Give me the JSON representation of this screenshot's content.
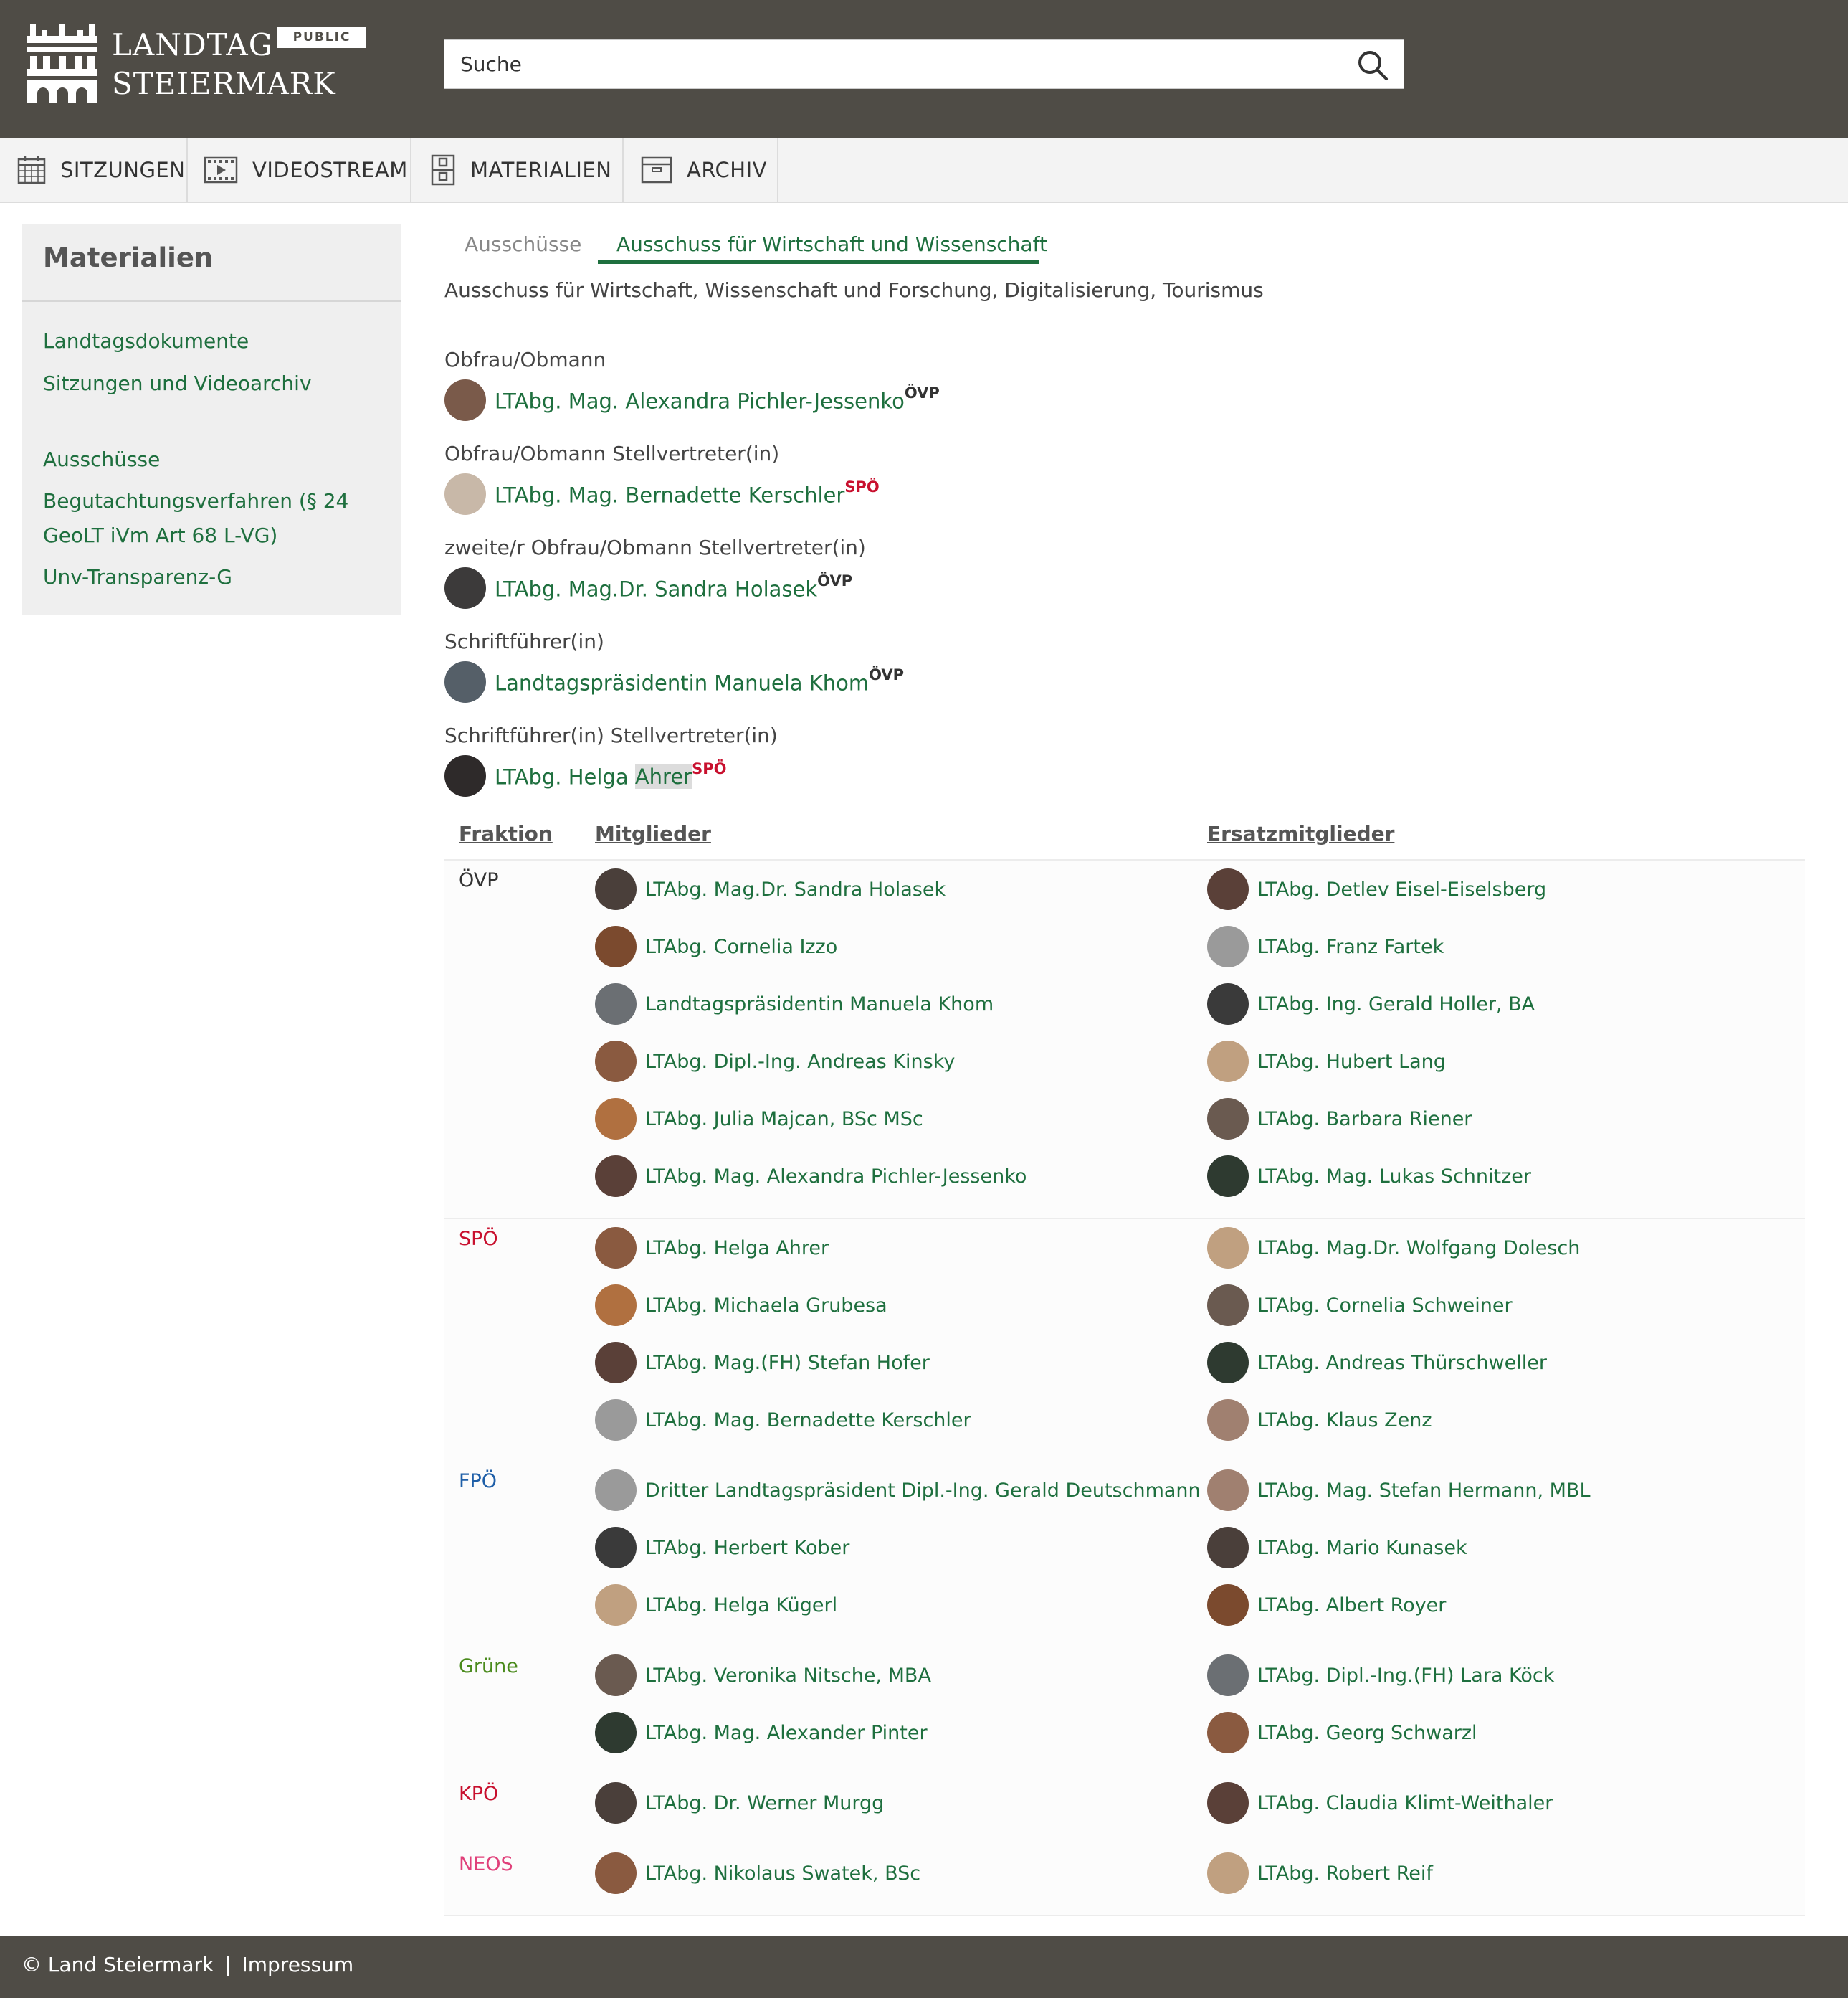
{
  "header": {
    "logo_line1": "LANDTAG",
    "logo_line2": "STEIERMARK",
    "badge": "PUBLIC",
    "search_placeholder": "Suche"
  },
  "nav": [
    {
      "label": "SITZUNGEN",
      "icon": "calendar-icon"
    },
    {
      "label": "VIDEOSTREAM",
      "icon": "video-icon"
    },
    {
      "label": "MATERIALIEN",
      "icon": "documents-icon"
    },
    {
      "label": "ARCHIV",
      "icon": "archive-box-icon"
    }
  ],
  "sidebar": {
    "title": "Materialien",
    "links": [
      {
        "label": "Landtagsdokumente"
      },
      {
        "label": "Sitzungen und Videoarchiv"
      },
      {
        "label": "Ausschüsse"
      },
      {
        "label": "Begutachtungsverfahren (§ 24"
      },
      {
        "label": "GeoLT iVm Art 68 L-VG)"
      },
      {
        "label": "Unv-Transparenz-G"
      }
    ]
  },
  "tabs": [
    {
      "label": "Ausschüsse"
    },
    {
      "label": "Ausschuss für Wirtschaft und Wissenschaft"
    }
  ],
  "subtitle": "Ausschuss für Wirtschaft, Wissenschaft und Forschung, Digitalisierung, Tourismus",
  "roles": [
    {
      "label": "Obfrau/Obmann",
      "name": "LTAbg. Mag. Alexandra Pichler-Jessenko",
      "party": "ÖVP"
    },
    {
      "label": "Obfrau/Obmann Stellvertreter(in)",
      "name": "LTAbg. Mag. Bernadette Kerschler",
      "party": "SPÖ"
    },
    {
      "label": "zweite/r Obfrau/Obmann Stellvertreter(in)",
      "name": "LTAbg. Mag.Dr. Sandra Holasek",
      "party": "ÖVP"
    },
    {
      "label": "Schriftführer(in)",
      "name": "Landtagspräsidentin Manuela Khom",
      "party": "ÖVP"
    },
    {
      "label": "Schriftführer(in) Stellvertreter(in)",
      "name": "LTAbg. Helga ",
      "name_hl": "Ahrer",
      "party": "SPÖ"
    }
  ],
  "table": {
    "headers": {
      "fraktion": "Fraktion",
      "mitglieder": "Mitglieder",
      "ersatz": "Ersatzmitglieder"
    },
    "groups": [
      {
        "fraktion": "ÖVP",
        "color": "#333333",
        "mitglieder": [
          "LTAbg. Mag.Dr. Sandra Holasek",
          "LTAbg. Cornelia Izzo",
          "Landtagspräsidentin Manuela Khom",
          "LTAbg. Dipl.-Ing. Andreas Kinsky",
          "LTAbg. Julia Majcan, BSc MSc",
          "LTAbg. Mag. Alexandra Pichler-Jessenko"
        ],
        "ersatz": [
          "LTAbg. Detlev Eisel-Eiselsberg",
          "LTAbg. Franz Fartek",
          "LTAbg. Ing. Gerald Holler, BA",
          "LTAbg. Hubert Lang",
          "LTAbg. Barbara Riener",
          "LTAbg. Mag. Lukas Schnitzer"
        ]
      },
      {
        "fraktion": "SPÖ",
        "color": "#c8102e",
        "mitglieder": [
          "LTAbg. Helga Ahrer",
          "LTAbg. Michaela Grubesa",
          "LTAbg. Mag.(FH) Stefan Hofer",
          "LTAbg. Mag. Bernadette Kerschler"
        ],
        "ersatz": [
          "LTAbg. Mag.Dr. Wolfgang Dolesch",
          "LTAbg. Cornelia Schweiner",
          "LTAbg. Andreas Thürschweller",
          "LTAbg. Klaus Zenz"
        ]
      },
      {
        "fraktion": "FPÖ",
        "color": "#1f5fa8",
        "mitglieder": [
          "Dritter Landtagspräsident Dipl.-Ing. Gerald Deutschmann",
          "LTAbg. Herbert Kober",
          "LTAbg. Helga Kügerl"
        ],
        "ersatz": [
          "LTAbg. Mag. Stefan Hermann, MBL",
          "LTAbg. Mario Kunasek",
          "LTAbg. Albert Royer"
        ]
      },
      {
        "fraktion": "Grüne",
        "color": "#4a8a1c",
        "mitglieder": [
          "LTAbg. Veronika Nitsche, MBA",
          "LTAbg. Mag. Alexander Pinter"
        ],
        "ersatz": [
          "LTAbg. Dipl.-Ing.(FH) Lara Köck",
          "LTAbg. Georg Schwarzl"
        ]
      },
      {
        "fraktion": "KPÖ",
        "color": "#c8102e",
        "mitglieder": [
          "LTAbg. Dr. Werner Murgg"
        ],
        "ersatz": [
          "LTAbg. Claudia Klimt-Weithaler"
        ]
      },
      {
        "fraktion": "NEOS",
        "color": "#e0407a",
        "mitglieder": [
          "LTAbg. Nikolaus Swatek, BSc"
        ],
        "ersatz": [
          "LTAbg. Robert Reif"
        ]
      }
    ]
  },
  "footer": {
    "copyright": "© Land Steiermark",
    "separator": "|",
    "impressum": "Impressum"
  },
  "colors": {
    "header_bg": "#4f4c46",
    "link_green": "#1e6f3e",
    "party_oevp": "#333333",
    "party_spoe": "#c8102e"
  }
}
